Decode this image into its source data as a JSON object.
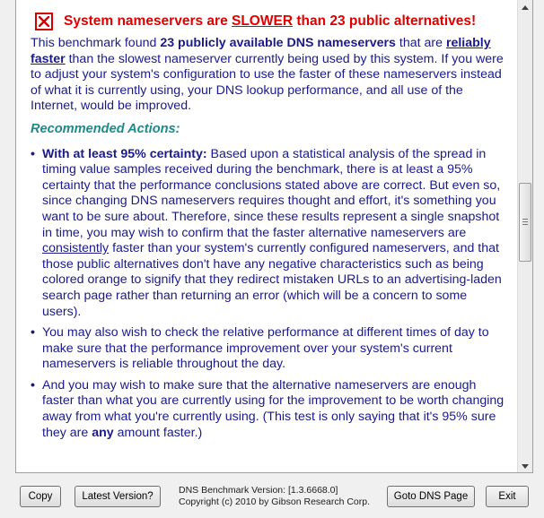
{
  "headline": {
    "pre": "System nameservers are ",
    "slower": "SLOWER",
    "post": " than 23 public alternatives!"
  },
  "intro": {
    "t1": "This benchmark found ",
    "b1": "23 publicly available DNS nameservers",
    "t2": " that are ",
    "u1": "reliably faster",
    "t3": " than the slowest nameserver currently being used by this system. If you were to adjust your system's configuration to use the faster of these nameservers instead of what it is currently using, your DNS lookup performance, and all use of the Internet, would be improved."
  },
  "recommended": "Recommended Actions:",
  "bullets": {
    "b1_bold": "With at least 95% certainty:",
    "b1_text1": "  Based upon a statistical analysis of the spread in timing value samples received during the benchmark, there is at least a 95% certainty that the performance conclusions stated above are correct. But even so, since changing DNS nameservers requires thought and effort, it's something you want to be sure about. Therefore, since these results represent a single snapshot in time, you may wish to confirm that the faster alternative nameservers are ",
    "b1_under": "consistently",
    "b1_text2": " faster than your system's currently configured nameservers, and that those public alternatives don't have any negative characteristics such as being colored orange to signify that they redirect mistaken URLs to an advertising-laden search page rather than returning an error (which will be a concern to some users).",
    "b2": "You may also wish to check the relative performance at different times of day to make sure that the performance improvement over your system's current nameservers is reliable throughout the day.",
    "b3_text1": "And you may wish to make sure that the alternative nameservers are enough faster than what you are currently using for the improvement to be worth changing away from what you're currently using. (This test is only saying that it's 95% sure they are ",
    "b3_bold": "any",
    "b3_text2": " amount faster.)"
  },
  "footer": {
    "copy": "Copy",
    "latest": "Latest Version?",
    "version": "DNS Benchmark Version: [1.3.6668.0]",
    "copyright": "Copyright (c) 2010 by Gibson Research Corp.",
    "goto": "Goto DNS Page",
    "exit": "Exit"
  },
  "icons": {
    "headline": "error-x-icon",
    "scroll_up": "scroll-up-arrow-icon",
    "scroll_down": "scroll-down-arrow-icon"
  },
  "colors": {
    "headline_red": "#e00000",
    "body_navy": "#1a1a8c",
    "recommended_teal": "#1d8a8a"
  }
}
